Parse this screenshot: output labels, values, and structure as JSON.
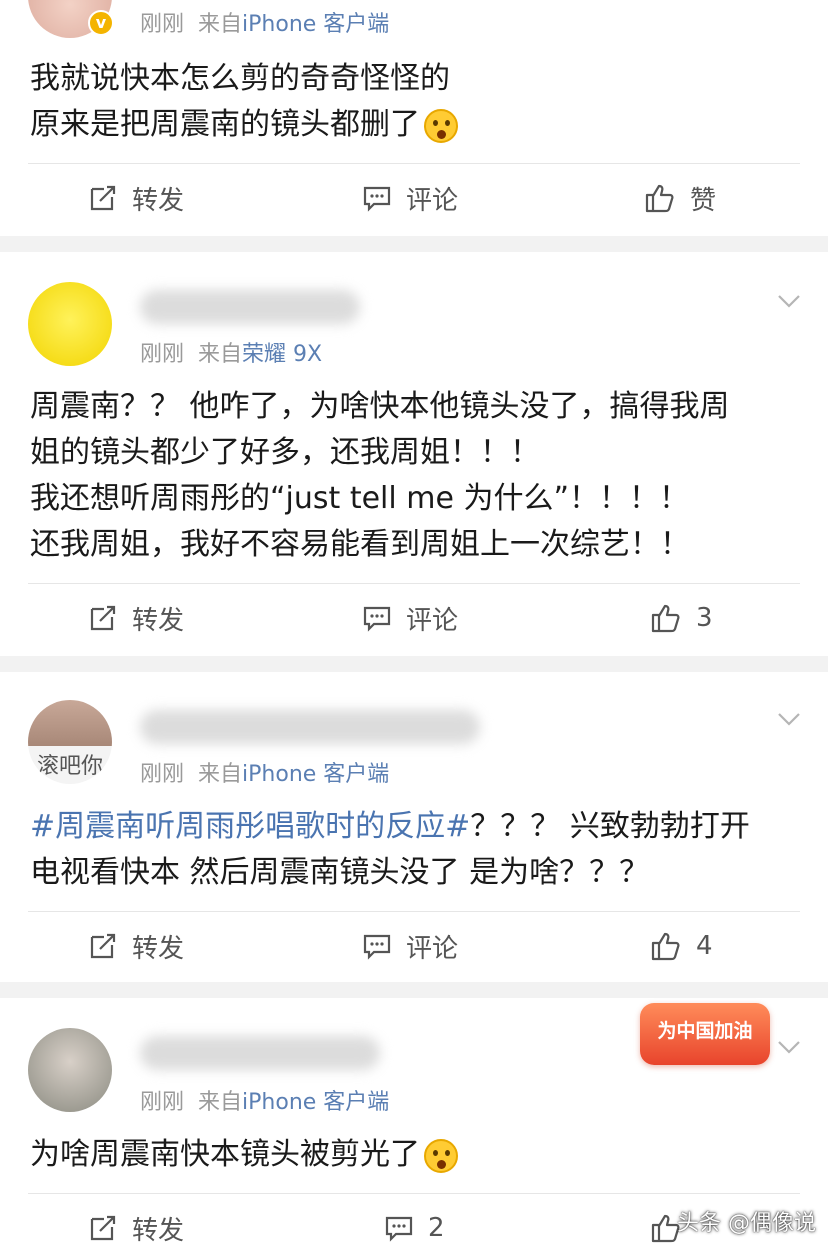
{
  "posts": [
    {
      "time": "刚刚",
      "source_prefix": "来自",
      "source": "iPhone 客户端",
      "lines": [
        "我就说快本怎么剪的奇奇怪怪的",
        "原来是把周震南的镜头都删了"
      ],
      "actions": {
        "repost": "转发",
        "comment": "评论",
        "like": "赞"
      }
    },
    {
      "time": "刚刚",
      "source_prefix": "来自",
      "source": "荣耀 9X",
      "lines": [
        "周震南？？ 他咋了，为啥快本他镜头没了，搞得我周",
        "姐的镜头都少了好多，还我周姐！！！",
        "我还想听周雨彤的“just tell me 为什么”！！！！",
        "还我周姐，我好不容易能看到周姐上一次综艺！！"
      ],
      "actions": {
        "repost": "转发",
        "comment": "评论",
        "like": "3"
      }
    },
    {
      "time": "刚刚",
      "source_prefix": "来自",
      "source": "iPhone 客户端",
      "avatar_text": "滚吧你",
      "topic": "#周震南听周雨彤唱歌时的反应#",
      "line1_rest": "？？？ 兴致勃勃打开",
      "line2": "电视看快本 然后周震南镜头没了 是为啥？？？",
      "actions": {
        "repost": "转发",
        "comment": "评论",
        "like": "4"
      }
    },
    {
      "time": "刚刚",
      "source_prefix": "来自",
      "source": "iPhone 客户端",
      "badge": "为中国加油",
      "lines": [
        "为啥周震南快本镜头被剪光了"
      ],
      "actions": {
        "repost": "转发",
        "comment": "2"
      }
    }
  ],
  "watermark": "头条 @偶像说"
}
